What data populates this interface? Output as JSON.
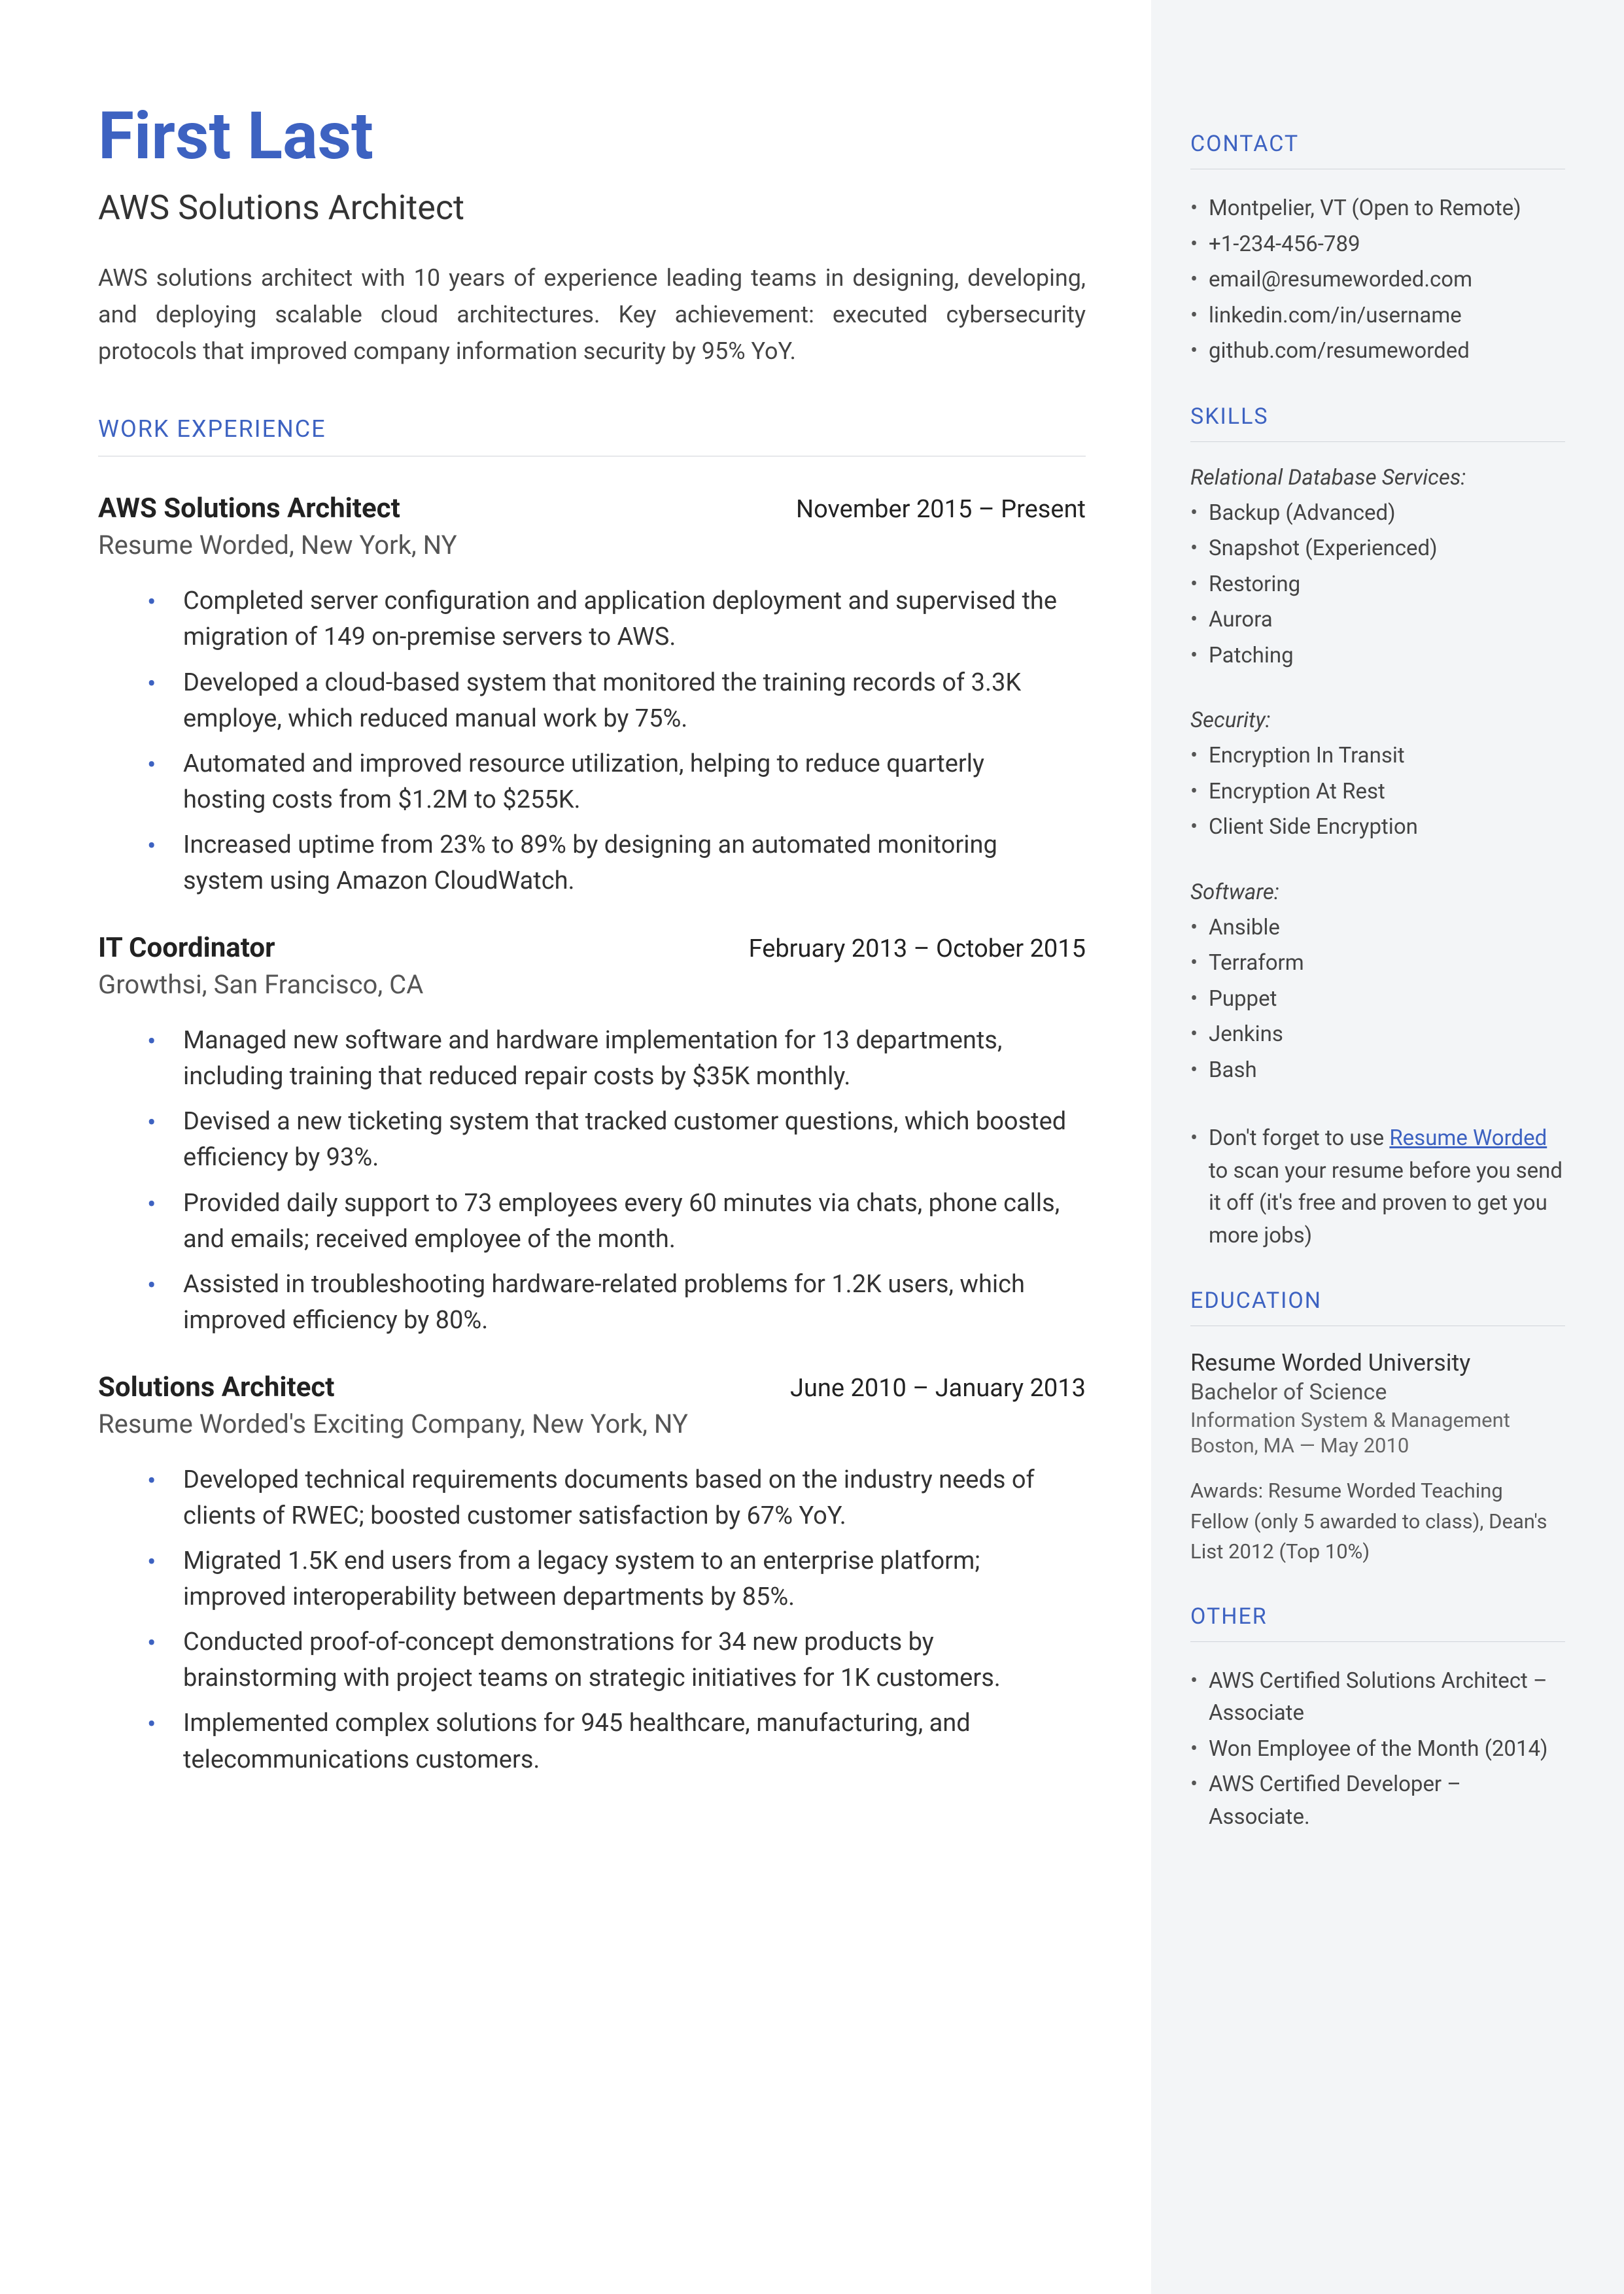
{
  "name": "First Last",
  "title": "AWS Solutions Architect",
  "summary": "AWS solutions architect with 10 years of experience leading teams in designing, developing, and deploying scalable cloud architectures. Key achievement: executed cybersecurity protocols that improved company information security by 95% YoY.",
  "work_heading": "WORK EXPERIENCE",
  "jobs": [
    {
      "title": "AWS Solutions Architect",
      "dates": "November 2015 – Present",
      "company": "Resume Worded, New York, NY",
      "bullets": [
        "Completed server configuration and application deployment and supervised the migration of 149 on-premise servers to AWS.",
        "Developed a cloud-based system that monitored the training records of 3.3K employe, which reduced manual work by 75%.",
        "Automated and improved resource utilization, helping to reduce quarterly hosting costs from $1.2M to $255K.",
        "Increased uptime from 23% to 89% by designing an automated monitoring system using Amazon CloudWatch."
      ]
    },
    {
      "title": "IT Coordinator",
      "dates": "February 2013 – October 2015",
      "company": "Growthsi, San Francisco, CA",
      "bullets": [
        "Managed new software and hardware implementation for 13 departments, including training that reduced repair costs by $35K monthly.",
        "Devised a new ticketing system that tracked customer questions, which boosted efficiency by 93%.",
        "Provided daily support to 73 employees every 60 minutes via chats, phone calls, and emails; received employee of the month.",
        "Assisted in troubleshooting hardware-related problems for 1.2K users, which improved efficiency by 80%."
      ]
    },
    {
      "title": "Solutions Architect",
      "dates": "June 2010 – January 2013",
      "company": "Resume Worded's Exciting Company, New York, NY",
      "bullets": [
        "Developed technical requirements documents based on the industry needs of clients of RWEC; boosted customer satisfaction by 67% YoY.",
        "Migrated 1.5K end users from a legacy system to an enterprise platform; improved interoperability between departments by 85%.",
        "Conducted proof-of-concept demonstrations for 34 new products by brainstorming with project teams on strategic initiatives for 1K customers.",
        "Implemented complex solutions for 945 healthcare, manufacturing, and telecommunications customers."
      ]
    }
  ],
  "contact_heading": "CONTACT",
  "contact": [
    "Montpelier, VT (Open to Remote)",
    "+1-234-456-789",
    "email@resumeworded.com",
    "linkedin.com/in/username",
    "github.com/resumeworded"
  ],
  "skills_heading": "SKILLS",
  "skills": {
    "group1_head": "Relational Database Services:",
    "group1": [
      "Backup (Advanced)",
      "Snapshot (Experienced)",
      "Restoring",
      "Aurora",
      "Patching"
    ],
    "group2_head": "Security:",
    "group2": [
      "Encryption In Transit",
      "Encryption At Rest",
      "Client Side Encryption"
    ],
    "group3_head": "Software:",
    "group3": [
      "Ansible",
      "Terraform",
      "Puppet",
      "Jenkins",
      "Bash"
    ]
  },
  "note_prefix": "Don't forget to use ",
  "note_link": "Resume Worded",
  "note_suffix": " to scan your resume before you send it off (it's free and proven to get you more jobs)",
  "education_heading": "EDUCATION",
  "education": {
    "school": "Resume Worded University",
    "degree": "Bachelor of Science",
    "field": "Information System & Management",
    "loc": "Boston, MA — May 2010",
    "awards": "Awards: Resume Worded Teaching Fellow (only 5 awarded to class), Dean's List 2012 (Top 10%)"
  },
  "other_heading": "OTHER",
  "other": [
    "AWS Certified Solutions Architect – Associate",
    "Won Employee of the Month (2014)",
    "AWS Certified Developer – Associate."
  ]
}
